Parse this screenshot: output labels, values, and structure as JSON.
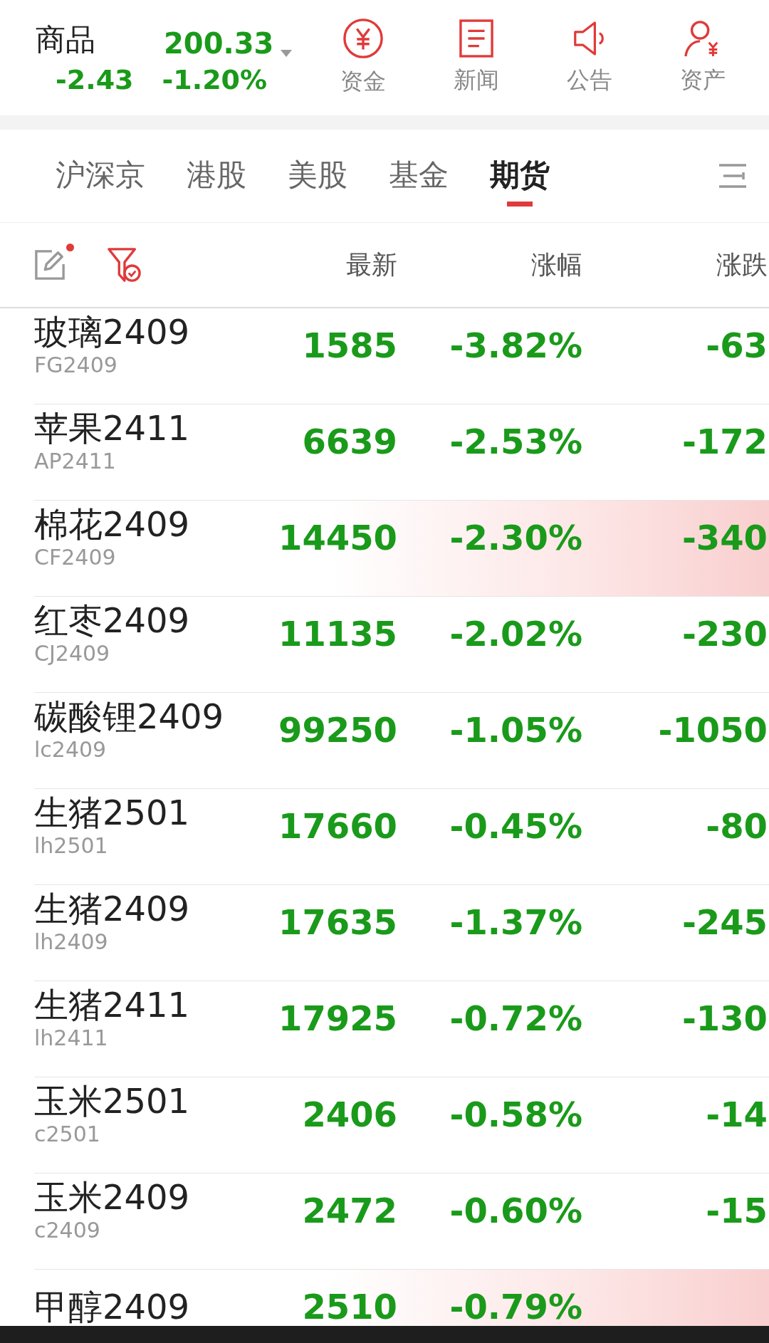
{
  "index": {
    "name": "商品",
    "value": "200.33",
    "change": "-2.43",
    "percent": "-1.20%"
  },
  "shortcuts": [
    {
      "kind": "fund",
      "label": "资金"
    },
    {
      "kind": "news",
      "label": "新闻"
    },
    {
      "kind": "notice",
      "label": "公告"
    },
    {
      "kind": "assets",
      "label": "资产"
    }
  ],
  "tabs": [
    {
      "label": "沪深京",
      "selected": false
    },
    {
      "label": "港股",
      "selected": false
    },
    {
      "label": "美股",
      "selected": false
    },
    {
      "label": "基金",
      "selected": false
    },
    {
      "label": "期货",
      "selected": true
    }
  ],
  "table": {
    "edit_badge": true,
    "columns": [
      "最新",
      "涨幅",
      "涨跌"
    ],
    "rows": [
      {
        "name": "玻璃2409",
        "code": "FG2409",
        "latest": "1585",
        "percent": "-3.82%",
        "change": "-63",
        "highlighted": false
      },
      {
        "name": "苹果2411",
        "code": "AP2411",
        "latest": "6639",
        "percent": "-2.53%",
        "change": "-172",
        "highlighted": false
      },
      {
        "name": "棉花2409",
        "code": "CF2409",
        "latest": "14450",
        "percent": "-2.30%",
        "change": "-340",
        "highlighted": true
      },
      {
        "name": "红枣2409",
        "code": "CJ2409",
        "latest": "11135",
        "percent": "-2.02%",
        "change": "-230",
        "highlighted": false
      },
      {
        "name": "碳酸锂2409",
        "code": "lc2409",
        "latest": "99250",
        "percent": "-1.05%",
        "change": "-1050",
        "highlighted": false
      },
      {
        "name": "生猪2501",
        "code": "lh2501",
        "latest": "17660",
        "percent": "-0.45%",
        "change": "-80",
        "highlighted": false
      },
      {
        "name": "生猪2409",
        "code": "lh2409",
        "latest": "17635",
        "percent": "-1.37%",
        "change": "-245",
        "highlighted": false
      },
      {
        "name": "生猪2411",
        "code": "lh2411",
        "latest": "17925",
        "percent": "-0.72%",
        "change": "-130",
        "highlighted": false
      },
      {
        "name": "玉米2501",
        "code": "c2501",
        "latest": "2406",
        "percent": "-0.58%",
        "change": "-14",
        "highlighted": false
      },
      {
        "name": "玉米2409",
        "code": "c2409",
        "latest": "2472",
        "percent": "-0.60%",
        "change": "-15",
        "highlighted": false
      },
      {
        "name": "甲醇2409",
        "latest": "2510",
        "percent": "-0.79%",
        "highlighted": true
      }
    ]
  }
}
